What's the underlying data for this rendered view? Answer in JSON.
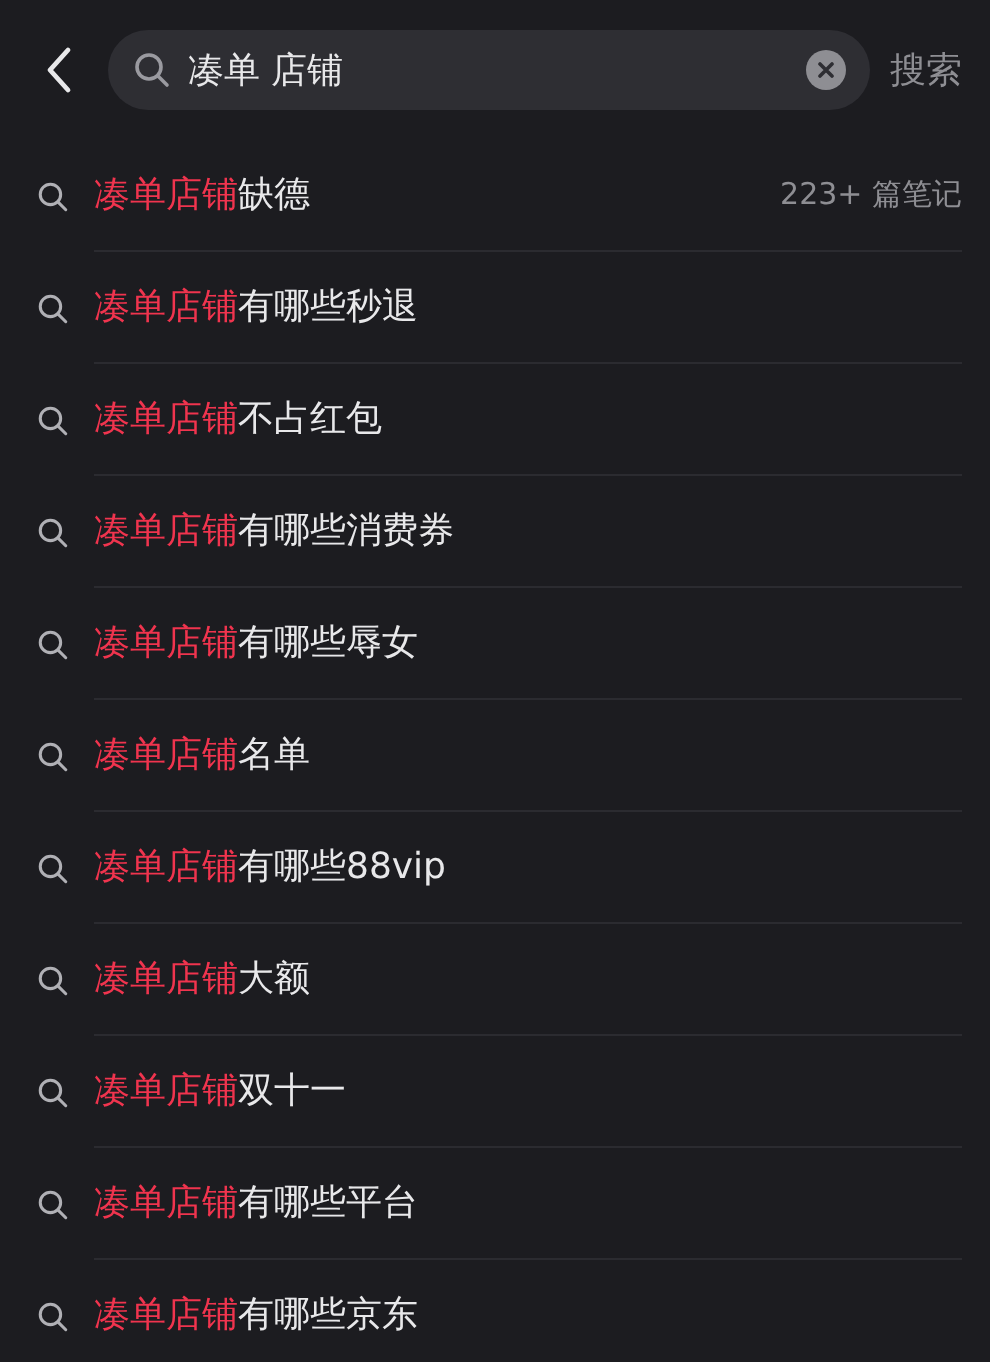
{
  "search": {
    "value": "凑单 店铺",
    "action": "搜索"
  },
  "suggestions": [
    {
      "match": "凑单店铺",
      "rest": "缺德",
      "meta": "223+ 篇笔记"
    },
    {
      "match": "凑单店铺",
      "rest": "有哪些秒退"
    },
    {
      "match": "凑单店铺",
      "rest": "不占红包"
    },
    {
      "match": "凑单店铺",
      "rest": "有哪些消费券"
    },
    {
      "match": "凑单店铺",
      "rest": "有哪些辱女"
    },
    {
      "match": "凑单店铺",
      "rest": "名单"
    },
    {
      "match": "凑单店铺",
      "rest": "有哪些88vip"
    },
    {
      "match": "凑单店铺",
      "rest": "大额"
    },
    {
      "match": "凑单店铺",
      "rest": "双十一"
    },
    {
      "match": "凑单店铺",
      "rest": "有哪些平台"
    },
    {
      "match": "凑单店铺",
      "rest": "有哪些京东"
    }
  ]
}
